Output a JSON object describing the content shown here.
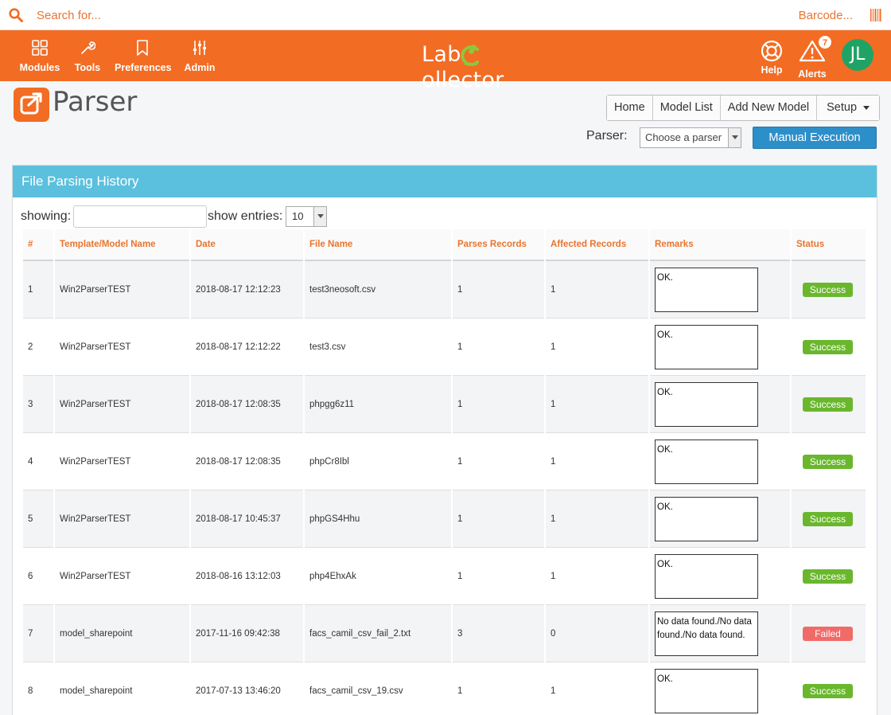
{
  "search": {
    "placeholder": "Search for...",
    "barcode_label": "Barcode..."
  },
  "nav": {
    "modules": "Modules",
    "tools": "Tools",
    "preferences": "Preferences",
    "admin": "Admin",
    "help": "Help",
    "alerts": "Alerts",
    "alerts_count": "7",
    "avatar_initials": "JL"
  },
  "logo": {
    "part1": "Lab",
    "part2": "ollector"
  },
  "page": {
    "title": "Parser"
  },
  "toolbar": {
    "home": "Home",
    "model_list": "Model List",
    "add_new_model": "Add New Model",
    "setup": "Setup",
    "parser_label": "Parser:",
    "parser_select": "Choose a parser",
    "manual_execution": "Manual Execution"
  },
  "panel": {
    "title": "File Parsing History",
    "showing_label": "showing:",
    "entries_label": "show entries:",
    "entries_value": "10"
  },
  "table": {
    "headers": [
      "#",
      "Template/Model Name",
      "Date",
      "File Name",
      "Parses Records",
      "Affected Records",
      "Remarks",
      "Status"
    ],
    "rows": [
      {
        "num": "1",
        "model": "Win2ParserTEST",
        "date": "2018-08-17 12:12:23",
        "file": "test3neosoft.csv",
        "parses": "1",
        "affected": "1",
        "remarks": "OK.",
        "status": "Success"
      },
      {
        "num": "2",
        "model": "Win2ParserTEST",
        "date": "2018-08-17 12:12:22",
        "file": "test3.csv",
        "parses": "1",
        "affected": "1",
        "remarks": "OK.",
        "status": "Success"
      },
      {
        "num": "3",
        "model": "Win2ParserTEST",
        "date": "2018-08-17 12:08:35",
        "file": "phpgg6z11",
        "parses": "1",
        "affected": "1",
        "remarks": "OK.",
        "status": "Success"
      },
      {
        "num": "4",
        "model": "Win2ParserTEST",
        "date": "2018-08-17 12:08:35",
        "file": "phpCr8Ibl",
        "parses": "1",
        "affected": "1",
        "remarks": "OK.",
        "status": "Success"
      },
      {
        "num": "5",
        "model": "Win2ParserTEST",
        "date": "2018-08-17 10:45:37",
        "file": "phpGS4Hhu",
        "parses": "1",
        "affected": "1",
        "remarks": "OK.",
        "status": "Success"
      },
      {
        "num": "6",
        "model": "Win2ParserTEST",
        "date": "2018-08-16 13:12:03",
        "file": "php4EhxAk",
        "parses": "1",
        "affected": "1",
        "remarks": "OK.",
        "status": "Success"
      },
      {
        "num": "7",
        "model": "model_sharepoint",
        "date": "2017-11-16 09:42:38",
        "file": "facs_camil_csv_fail_2.txt",
        "parses": "3",
        "affected": "0",
        "remarks": "No data found./No data found./No data found.",
        "status": "Failed"
      },
      {
        "num": "8",
        "model": "model_sharepoint",
        "date": "2017-07-13 13:46:20",
        "file": "facs_camil_csv_19.csv",
        "parses": "1",
        "affected": "1",
        "remarks": "OK.",
        "status": "Success"
      }
    ]
  },
  "colors": {
    "brand_orange": "#f26c23",
    "panel_header": "#5bc0de",
    "success": "#6ab72e",
    "failed": "#f06b67",
    "primary_button": "#2d8fc9",
    "avatar": "#1ea365"
  }
}
